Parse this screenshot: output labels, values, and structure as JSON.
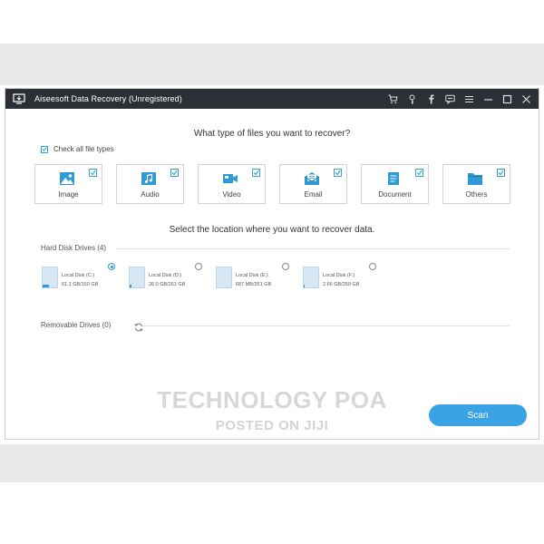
{
  "window": {
    "title": "Aiseesoft Data Recovery (Unregistered)"
  },
  "titlebar_buttons": [
    "cart-icon",
    "key-icon",
    "facebook-icon",
    "feedback-icon",
    "menu-icon",
    "minimize-icon",
    "maximize-icon",
    "close-icon"
  ],
  "file_types": {
    "heading": "What type of files you want to recover?",
    "check_all_label": "Check all file types",
    "check_all_checked": true,
    "items": [
      {
        "label": "Image",
        "icon": "image-icon",
        "checked": true
      },
      {
        "label": "Audio",
        "icon": "audio-icon",
        "checked": true
      },
      {
        "label": "Video",
        "icon": "video-icon",
        "checked": true
      },
      {
        "label": "Email",
        "icon": "email-icon",
        "checked": true
      },
      {
        "label": "Document",
        "icon": "document-icon",
        "checked": true
      },
      {
        "label": "Others",
        "icon": "others-icon",
        "checked": true
      }
    ]
  },
  "location": {
    "heading": "Select the location where you want to recover data.",
    "hard_disk_label": "Hard Disk Drives (4)",
    "drives": [
      {
        "name": "Local Disk (C:)",
        "size": "61.1 GB/150 GB",
        "selected": true,
        "used_fraction": 0.41
      },
      {
        "name": "Local Disk (D:)",
        "size": "26.0 GB/261 GB",
        "selected": false,
        "used_fraction": 0.1
      },
      {
        "name": "Local Disk (E:)",
        "size": "687 MB/261 GB",
        "selected": false,
        "used_fraction": 0.0
      },
      {
        "name": "Local Disk (F:)",
        "size": "2.66 GB/259 GB",
        "selected": false,
        "used_fraction": 0.01
      }
    ],
    "removable_label": "Removable Drives (0)"
  },
  "scan_button": "Scan",
  "watermark": {
    "line1": "TECHNOLOGY POA",
    "line2": "POSTED ON JIJI"
  },
  "colors": {
    "accent": "#3aa3e3",
    "titlebar": "#2c2f36"
  }
}
